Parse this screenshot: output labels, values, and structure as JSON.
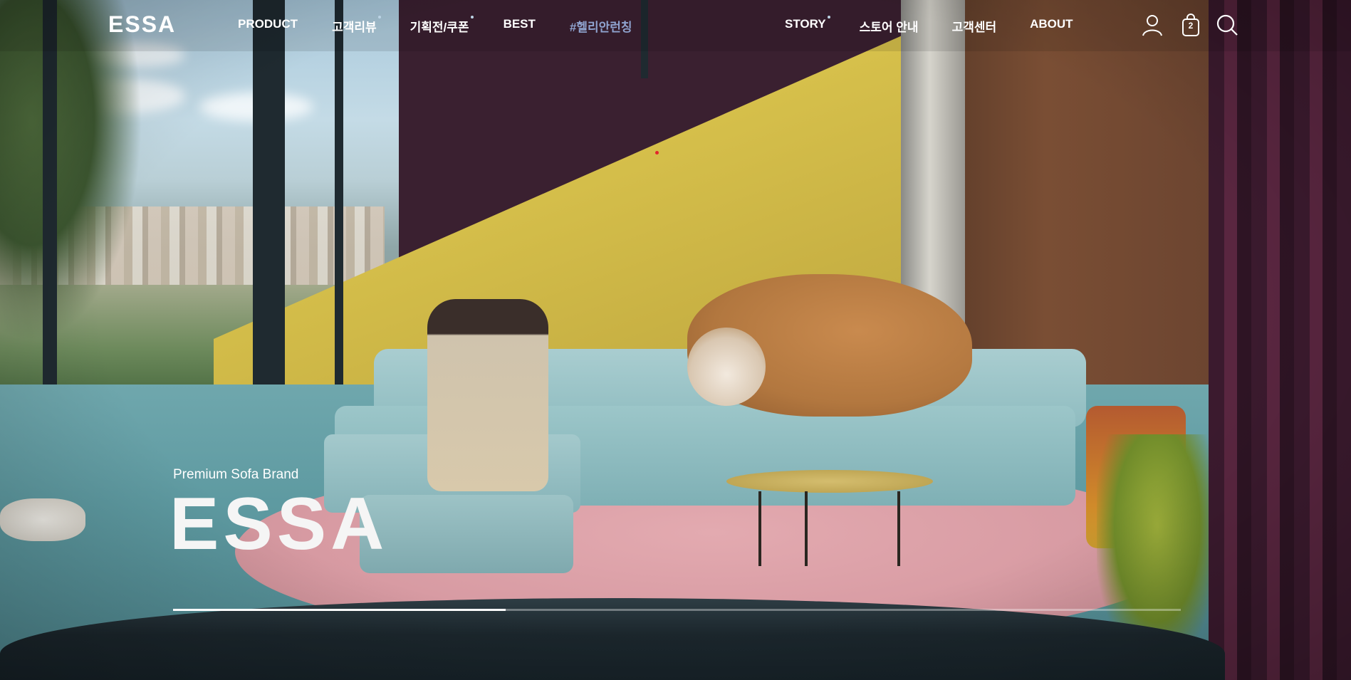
{
  "brand": {
    "logo": "ESSA"
  },
  "nav": {
    "left": [
      {
        "label": "PRODUCT",
        "dot": false,
        "highlight": false
      },
      {
        "label": "고객리뷰",
        "dot": true,
        "highlight": false
      },
      {
        "label": "기획전/쿠폰",
        "dot": true,
        "highlight": false
      },
      {
        "label": "BEST",
        "dot": false,
        "highlight": false
      },
      {
        "label": "#헬리안런칭",
        "dot": false,
        "highlight": true
      }
    ],
    "right": [
      {
        "label": "STORY",
        "dot": true
      },
      {
        "label": "스토어 안내",
        "dot": false
      },
      {
        "label": "고객센터",
        "dot": false
      },
      {
        "label": "ABOUT",
        "dot": false
      }
    ]
  },
  "header_icons": {
    "account": "user-icon",
    "cart": "shopping-bag-icon",
    "cart_count": "2",
    "search": "search-icon"
  },
  "hero": {
    "subtitle": "Premium Sofa Brand",
    "title": "ESSA"
  },
  "slider": {
    "progress_fraction": 0.33
  },
  "colors": {
    "text": "#ffffff",
    "nav_highlight": "#8fa3cf",
    "dot": "#bcd4e6"
  }
}
